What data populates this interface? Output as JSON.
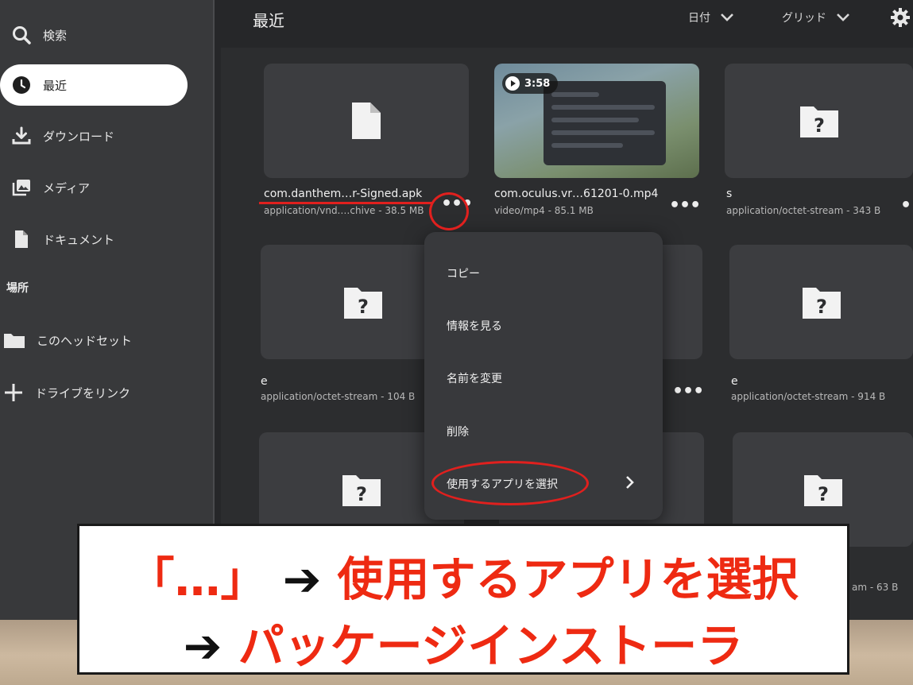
{
  "sidebar": {
    "items": [
      {
        "label": "検索",
        "icon": "search-icon"
      },
      {
        "label": "最近",
        "icon": "clock-icon"
      },
      {
        "label": "ダウンロード",
        "icon": "download-icon"
      },
      {
        "label": "メディア",
        "icon": "media-icon"
      },
      {
        "label": "ドキュメント",
        "icon": "document-icon"
      }
    ],
    "section_label": "場所",
    "places": [
      {
        "label": "このヘッドセット",
        "icon": "folder-icon"
      },
      {
        "label": "ドライブをリンク",
        "icon": "plus-icon"
      }
    ]
  },
  "header": {
    "title": "最近",
    "sort_label": "日付",
    "view_label": "グリッド",
    "settings_icon": "gear-icon"
  },
  "files": [
    {
      "name": "com.danthem…r-Signed.apk",
      "meta": "application/vnd.…chive - 38.5 MB",
      "icon": "file-icon"
    },
    {
      "name": "com.oculus.vr…61201-0.mp4",
      "meta": "video/mp4 - 85.1 MB",
      "duration": "3:58",
      "icon": "play-icon"
    },
    {
      "name": "s",
      "meta": "application/octet-stream - 343 B",
      "icon": "unknown-folder-icon"
    },
    {
      "name": "e",
      "meta": "application/octet-stream - 104 B",
      "icon": "unknown-folder-icon"
    },
    {
      "name": "",
      "meta": "",
      "icon": "unknown-folder-icon"
    },
    {
      "name": "e",
      "meta": "application/octet-stream - 914 B",
      "icon": "unknown-folder-icon"
    },
    {
      "name": "",
      "meta": "",
      "icon": "unknown-folder-icon"
    },
    {
      "name": "",
      "meta": "",
      "icon": "unknown-folder-icon"
    },
    {
      "name": "",
      "meta": "am - 63 B",
      "icon": "unknown-folder-icon"
    }
  ],
  "context_menu": {
    "items": [
      "コピー",
      "情報を見る",
      "名前を変更",
      "削除",
      "使用するアプリを選択"
    ],
    "submenu_icon": "chevron-right-icon"
  },
  "caption": {
    "line1_quote": "「…」",
    "line1_arrow": "➔",
    "line1_text": "使用するアプリを選択",
    "line2_arrow": "➔",
    "line2_text": "パッケージインストーラ"
  },
  "colors": {
    "annotation_red": "#e0201e",
    "caption_red": "#ee2a12",
    "active_nav_bg": "#ffffff"
  }
}
